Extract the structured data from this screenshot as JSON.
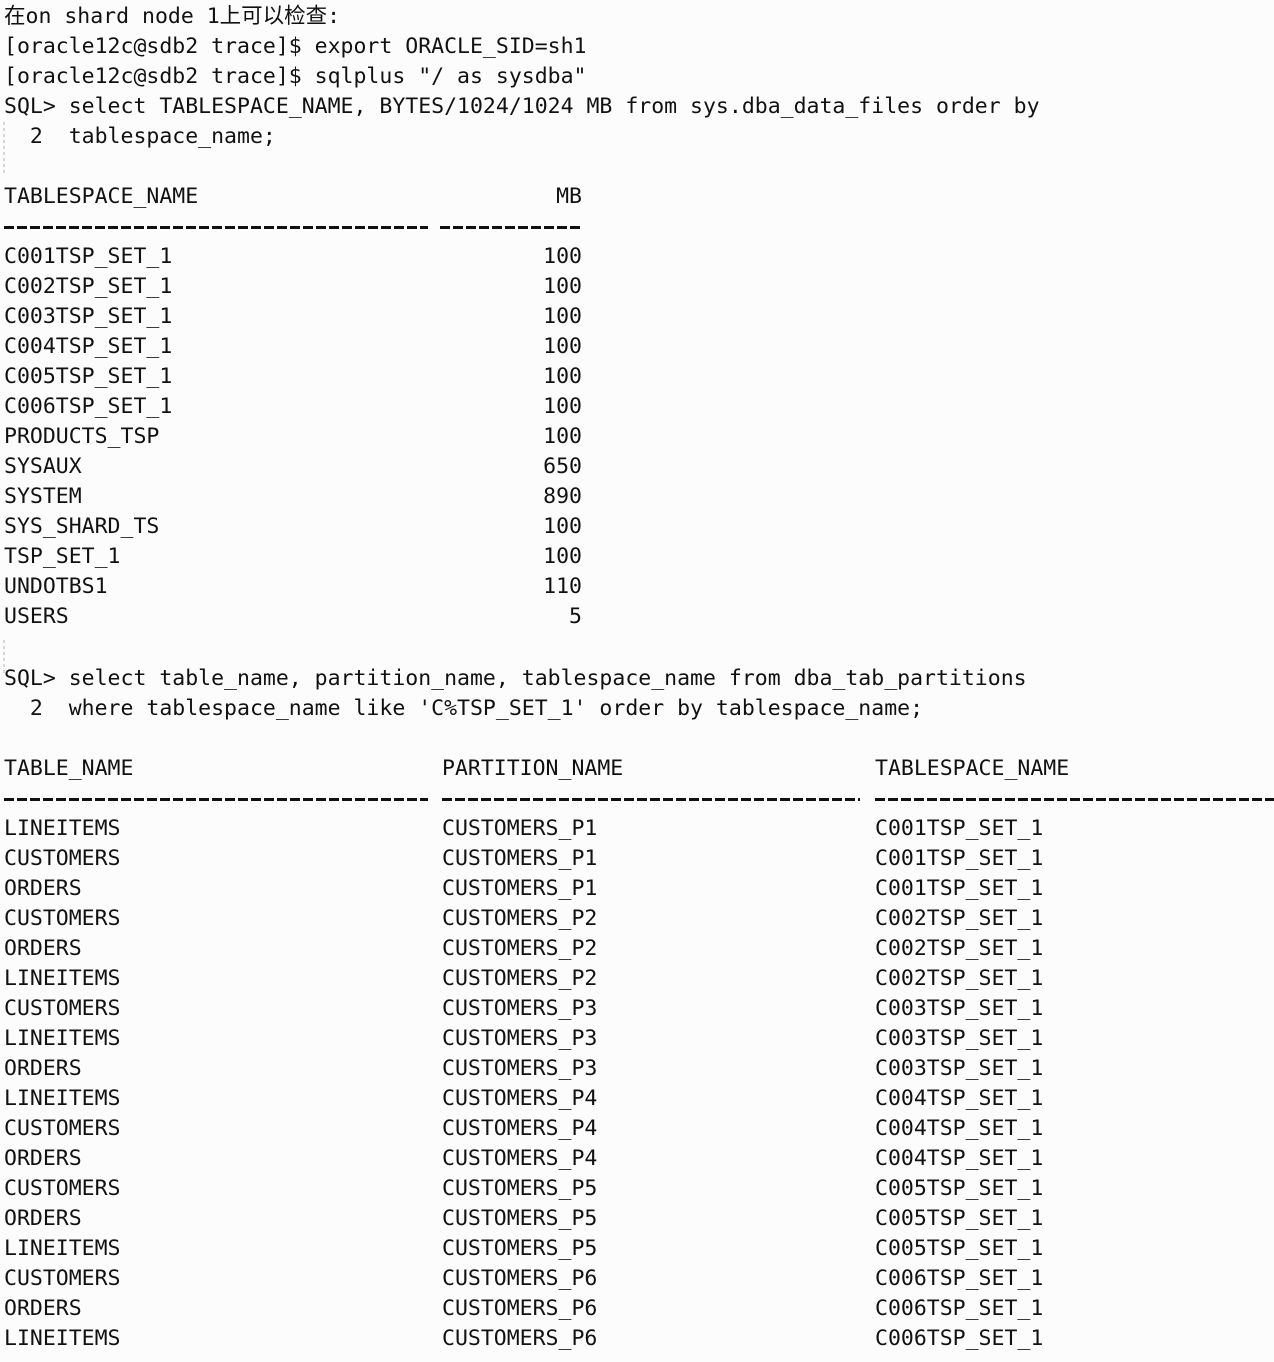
{
  "header": {
    "note": "在on shard node 1上可以检查:",
    "shell_lines": [
      "[oracle12c@sdb2 trace]$ export ORACLE_SID=sh1",
      "[oracle12c@sdb2 trace]$ sqlplus \"/ as sysdba\""
    ]
  },
  "query1": {
    "line1": "SQL> select TABLESPACE_NAME, BYTES/1024/1024 MB from sys.dba_data_files order by",
    "line2": "  2  tablespace_name;"
  },
  "table1": {
    "headers": [
      "TABLESPACE_NAME",
      "MB"
    ],
    "separator": [
      "--------------------------------",
      "----------"
    ],
    "rows": [
      {
        "tablespace_name": "C001TSP_SET_1",
        "mb": "100"
      },
      {
        "tablespace_name": "C002TSP_SET_1",
        "mb": "100"
      },
      {
        "tablespace_name": "C003TSP_SET_1",
        "mb": "100"
      },
      {
        "tablespace_name": "C004TSP_SET_1",
        "mb": "100"
      },
      {
        "tablespace_name": "C005TSP_SET_1",
        "mb": "100"
      },
      {
        "tablespace_name": "C006TSP_SET_1",
        "mb": "100"
      },
      {
        "tablespace_name": "PRODUCTS_TSP",
        "mb": "100"
      },
      {
        "tablespace_name": "SYSAUX",
        "mb": "650"
      },
      {
        "tablespace_name": "SYSTEM",
        "mb": "890"
      },
      {
        "tablespace_name": "SYS_SHARD_TS",
        "mb": "100"
      },
      {
        "tablespace_name": "TSP_SET_1",
        "mb": "100"
      },
      {
        "tablespace_name": "UNDOTBS1",
        "mb": "110"
      },
      {
        "tablespace_name": "USERS",
        "mb": "5"
      }
    ]
  },
  "query2": {
    "line1": "SQL> select table_name, partition_name, tablespace_name from dba_tab_partitions",
    "line2": "  2  where tablespace_name like 'C%TSP_SET_1' order by tablespace_name;"
  },
  "table2": {
    "headers": [
      "TABLE_NAME",
      "PARTITION_NAME",
      "TABLESPACE_NAME"
    ],
    "rows": [
      {
        "table_name": "LINEITEMS",
        "partition_name": "CUSTOMERS_P1",
        "tablespace_name": "C001TSP_SET_1"
      },
      {
        "table_name": "CUSTOMERS",
        "partition_name": "CUSTOMERS_P1",
        "tablespace_name": "C001TSP_SET_1"
      },
      {
        "table_name": "ORDERS",
        "partition_name": "CUSTOMERS_P1",
        "tablespace_name": "C001TSP_SET_1"
      },
      {
        "table_name": "CUSTOMERS",
        "partition_name": "CUSTOMERS_P2",
        "tablespace_name": "C002TSP_SET_1"
      },
      {
        "table_name": "ORDERS",
        "partition_name": "CUSTOMERS_P2",
        "tablespace_name": "C002TSP_SET_1"
      },
      {
        "table_name": "LINEITEMS",
        "partition_name": "CUSTOMERS_P2",
        "tablespace_name": "C002TSP_SET_1"
      },
      {
        "table_name": "CUSTOMERS",
        "partition_name": "CUSTOMERS_P3",
        "tablespace_name": "C003TSP_SET_1"
      },
      {
        "table_name": "LINEITEMS",
        "partition_name": "CUSTOMERS_P3",
        "tablespace_name": "C003TSP_SET_1"
      },
      {
        "table_name": "ORDERS",
        "partition_name": "CUSTOMERS_P3",
        "tablespace_name": "C003TSP_SET_1"
      },
      {
        "table_name": "LINEITEMS",
        "partition_name": "CUSTOMERS_P4",
        "tablespace_name": "C004TSP_SET_1"
      },
      {
        "table_name": "CUSTOMERS",
        "partition_name": "CUSTOMERS_P4",
        "tablespace_name": "C004TSP_SET_1"
      },
      {
        "table_name": "ORDERS",
        "partition_name": "CUSTOMERS_P4",
        "tablespace_name": "C004TSP_SET_1"
      },
      {
        "table_name": "CUSTOMERS",
        "partition_name": "CUSTOMERS_P5",
        "tablespace_name": "C005TSP_SET_1"
      },
      {
        "table_name": "ORDERS",
        "partition_name": "CUSTOMERS_P5",
        "tablespace_name": "C005TSP_SET_1"
      },
      {
        "table_name": "LINEITEMS",
        "partition_name": "CUSTOMERS_P5",
        "tablespace_name": "C005TSP_SET_1"
      },
      {
        "table_name": "CUSTOMERS",
        "partition_name": "CUSTOMERS_P6",
        "tablespace_name": "C006TSP_SET_1"
      },
      {
        "table_name": "ORDERS",
        "partition_name": "CUSTOMERS_P6",
        "tablespace_name": "C006TSP_SET_1"
      },
      {
        "table_name": "LINEITEMS",
        "partition_name": "CUSTOMERS_P6",
        "tablespace_name": "C006TSP_SET_1"
      }
    ]
  },
  "colors": {
    "background": "#fdfcfd",
    "text": "#111111",
    "gutter_guide": "#d9d6da"
  }
}
